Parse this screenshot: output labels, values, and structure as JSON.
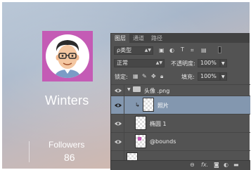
{
  "profile": {
    "name": "Winters",
    "followers_label": "Followers",
    "followers_count": "86",
    "avatar_tile_color": "#c45bb5"
  },
  "layers_panel": {
    "tabs": [
      {
        "label": "图层",
        "active": true
      },
      {
        "label": "通道",
        "active": false
      },
      {
        "label": "路径",
        "active": false
      }
    ],
    "filter": {
      "value": "ρ类型",
      "icons": [
        "image-filter-icon",
        "adjustment-filter-icon",
        "type-filter-icon",
        "shape-filter-icon",
        "smart-object-filter-icon"
      ]
    },
    "blend_mode": "正常",
    "opacity_label": "不透明度:",
    "opacity_value": "100%",
    "lock_label": "锁定:",
    "fill_label": "填充:",
    "fill_value": "100%",
    "layers": [
      {
        "name": "头像 .png",
        "type": "group",
        "expanded": true,
        "visible": true,
        "selected": false
      },
      {
        "name": "照片",
        "type": "layer",
        "visible": true,
        "selected": true,
        "clipped": true
      },
      {
        "name": "椭圆 1",
        "type": "shape",
        "visible": true,
        "selected": false
      },
      {
        "name": "@bounds",
        "type": "layer",
        "visible": true,
        "selected": false
      }
    ],
    "bottom_icons": [
      "link-icon",
      "fx-icon",
      "mask-icon",
      "adjustment-icon",
      "folder-icon"
    ]
  }
}
